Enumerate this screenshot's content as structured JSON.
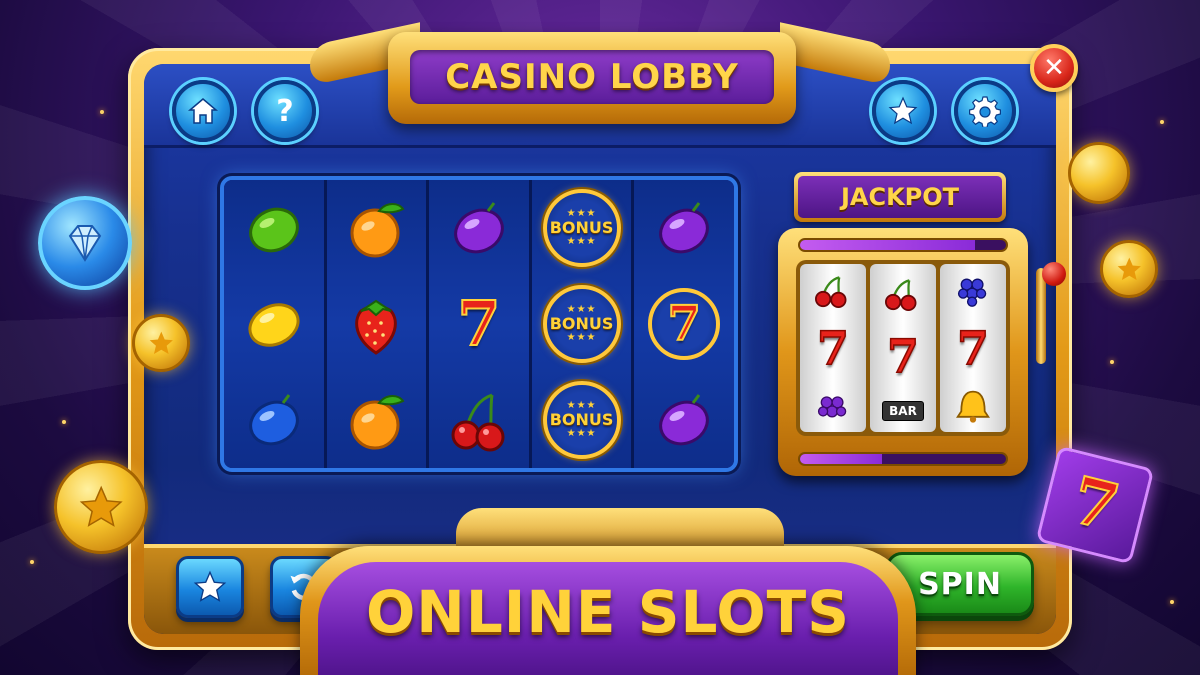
{
  "header": {
    "title": "CASINO LOBBY",
    "left_buttons": [
      {
        "name": "home",
        "icon": "home-icon"
      },
      {
        "name": "help",
        "icon": "question-icon",
        "glyph": "?"
      }
    ],
    "right_buttons": [
      {
        "name": "favorites",
        "icon": "star-icon"
      },
      {
        "name": "settings",
        "icon": "gear-icon"
      }
    ],
    "close_glyph": "✕"
  },
  "reels": {
    "columns": [
      [
        "lime",
        "lemon",
        "plum-blue"
      ],
      [
        "orange",
        "strawberry",
        "orange"
      ],
      [
        "plum-purple",
        "seven",
        "cherry"
      ],
      [
        "bonus",
        "bonus",
        "bonus"
      ],
      [
        "plum-purple",
        "seven-badge",
        "plum-purple"
      ]
    ],
    "bonus_label": "BONUS",
    "seven_glyph": "7"
  },
  "jackpot": {
    "label": "JACKPOT",
    "top_meter_fill": 0.85,
    "bottom_meter_fill": 0.4,
    "reels": [
      [
        "cherry",
        "seven",
        "grapes"
      ],
      [
        "cherry",
        "seven",
        "bar"
      ],
      [
        "grapes",
        "seven",
        "bell"
      ]
    ],
    "bar_label": "BAR"
  },
  "controls": {
    "spin_label": "SPIN",
    "buttons": [
      {
        "name": "favorite",
        "icon": "star-icon"
      },
      {
        "name": "autoplay",
        "icon": "refresh-icon"
      }
    ]
  },
  "banner": {
    "text": "ONLINE SLOTS"
  },
  "colors": {
    "gold": "#f5c22a",
    "purple": "#6a1fae",
    "blue": "#1a3499",
    "spin_green": "#2fb52a",
    "seven_red": "#e8231b"
  }
}
